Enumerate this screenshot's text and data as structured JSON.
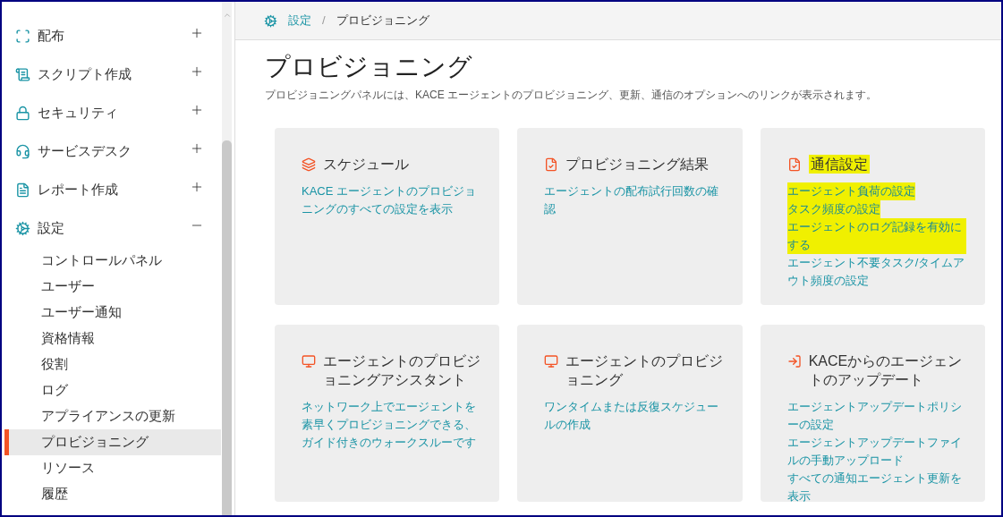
{
  "sidebar": {
    "items": [
      {
        "label": "配布",
        "expanded": false
      },
      {
        "label": "スクリプト作成",
        "expanded": false
      },
      {
        "label": "セキュリティ",
        "expanded": false
      },
      {
        "label": "サービスデスク",
        "expanded": false
      },
      {
        "label": "レポート作成",
        "expanded": false
      },
      {
        "label": "設定",
        "expanded": true,
        "children": [
          {
            "label": "コントロールパネル",
            "selected": false
          },
          {
            "label": "ユーザー",
            "selected": false
          },
          {
            "label": "ユーザー通知",
            "selected": false
          },
          {
            "label": "資格情報",
            "selected": false
          },
          {
            "label": "役割",
            "selected": false
          },
          {
            "label": "ログ",
            "selected": false
          },
          {
            "label": "アプライアンスの更新",
            "selected": false
          },
          {
            "label": "プロビジョニング",
            "selected": true
          },
          {
            "label": "リソース",
            "selected": false
          },
          {
            "label": "履歴",
            "selected": false
          }
        ]
      }
    ]
  },
  "breadcrumb": {
    "parent": "設定",
    "separator": "/",
    "current": "プロビジョニング"
  },
  "page": {
    "title": "プロビジョニング",
    "description": "プロビジョニングパネルには、KACE エージェントのプロビジョニング、更新、通信のオプションへのリンクが表示されます。"
  },
  "cards": [
    {
      "title": "スケジュール",
      "highlighted": false,
      "links": [
        {
          "text": "KACE エージェントのプロビジョニングのすべての設定を表示",
          "highlighted": false
        }
      ]
    },
    {
      "title": "プロビジョニング結果",
      "highlighted": false,
      "links": [
        {
          "text": "エージェントの配布試行回数の確認",
          "highlighted": false
        }
      ]
    },
    {
      "title": "通信設定",
      "highlighted": true,
      "links": [
        {
          "text": "エージェント負荷の設定",
          "highlighted": true
        },
        {
          "text": "タスク頻度の設定",
          "highlighted": true
        },
        {
          "text": "エージェントのログ記録を有効にする",
          "highlighted": true
        },
        {
          "text": "エージェント不要タスク/タイムアウト頻度の設定",
          "highlighted": false
        }
      ]
    },
    {
      "title": "エージェントのプロビジョニングアシスタント",
      "highlighted": false,
      "links": [
        {
          "text": "ネットワーク上でエージェントを素早くプロビジョニングできる、ガイド付きのウォークスルーです",
          "highlighted": false
        }
      ]
    },
    {
      "title": "エージェントのプロビジョニング",
      "highlighted": false,
      "links": [
        {
          "text": "ワンタイムまたは反復スケジュールの作成",
          "highlighted": false
        }
      ]
    },
    {
      "title": "KACEからのエージェントのアップデート",
      "highlighted": false,
      "links": [
        {
          "text": "エージェントアップデートポリシーの設定",
          "highlighted": false
        },
        {
          "text": "エージェントアップデートファイルの手動アップロード",
          "highlighted": false
        },
        {
          "text": "すべての通知エージェント更新を表示",
          "highlighted": false
        }
      ]
    }
  ]
}
